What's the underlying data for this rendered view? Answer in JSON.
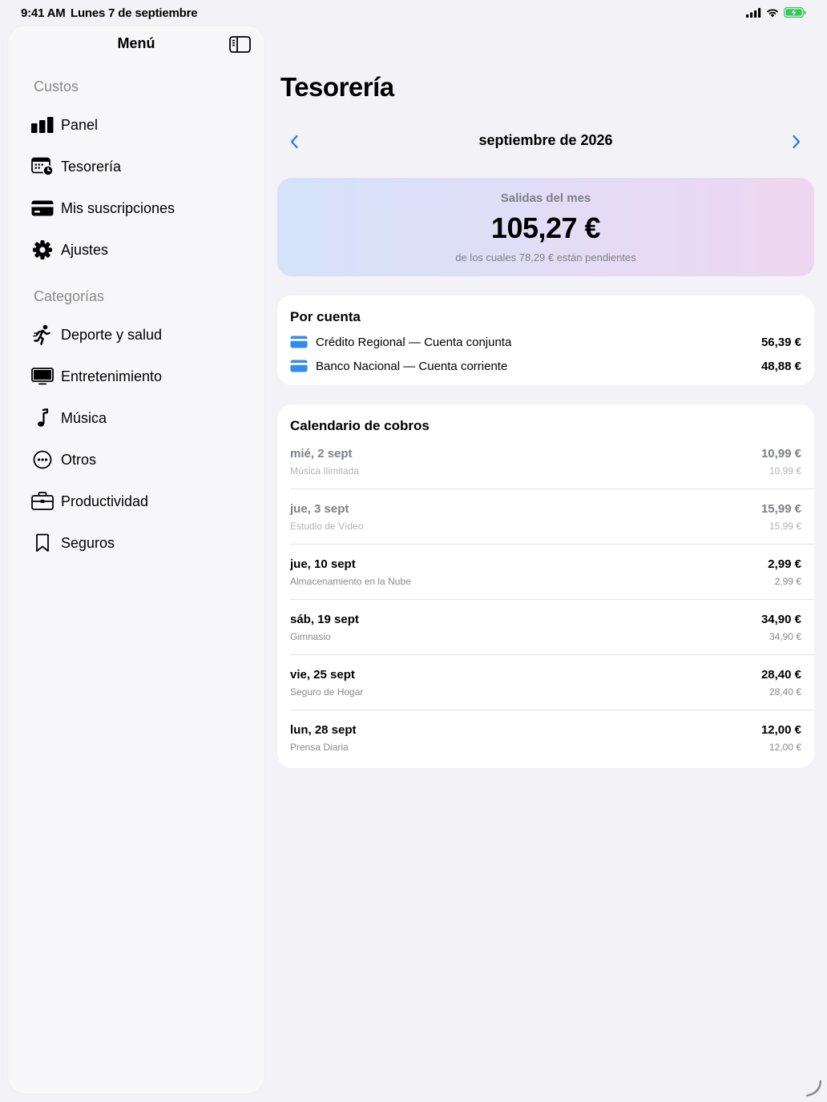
{
  "status": {
    "time": "9:41 AM",
    "date": "Lunes 7 de septiembre"
  },
  "sidebar": {
    "title": "Menú",
    "sections": [
      {
        "label": "Custos"
      },
      {
        "label": "Categorías"
      }
    ],
    "items": [
      {
        "label": "Panel",
        "icon": "chart-bar-icon"
      },
      {
        "label": "Tesorería",
        "icon": "calendar-clock-icon"
      },
      {
        "label": "Mis suscripciones",
        "icon": "credit-card-icon"
      },
      {
        "label": "Ajustes",
        "icon": "gear-icon"
      },
      {
        "label": "Deporte y salud",
        "icon": "running-figure-icon"
      },
      {
        "label": "Entretenimiento",
        "icon": "tv-icon"
      },
      {
        "label": "Música",
        "icon": "music-note-icon"
      },
      {
        "label": "Otros",
        "icon": "ellipsis-circle-icon"
      },
      {
        "label": "Productividad",
        "icon": "briefcase-icon"
      },
      {
        "label": "Seguros",
        "icon": "bookmark-icon"
      }
    ]
  },
  "main": {
    "title": "Tesorería",
    "month": "septiembre de 2026",
    "summary": {
      "label": "Salidas del mes",
      "amount": "105,27 €",
      "note": "de los cuales 78,29 € están pendientes"
    },
    "accounts": {
      "title": "Por cuenta",
      "rows": [
        {
          "name": "Crédito Regional — Cuenta conjunta",
          "amount": "56,39 €"
        },
        {
          "name": "Banco Nacional — Cuenta corriente",
          "amount": "48,88 €"
        }
      ]
    },
    "calendar": {
      "title": "Calendario de cobros",
      "rows": [
        {
          "date": "mié, 2 sept",
          "service": "Música Ilimitada",
          "amount": "10,99 €",
          "amount_sub": "10,99 €",
          "past": true
        },
        {
          "date": "jue, 3 sept",
          "service": "Estudio de Vídeo",
          "amount": "15,99 €",
          "amount_sub": "15,99 €",
          "past": true
        },
        {
          "date": "jue, 10 sept",
          "service": "Almacenamiento en la Nube",
          "amount": "2,99 €",
          "amount_sub": "2,99 €",
          "past": false
        },
        {
          "date": "sáb, 19 sept",
          "service": "Gimnasio",
          "amount": "34,90 €",
          "amount_sub": "34,90 €",
          "past": false
        },
        {
          "date": "vie, 25 sept",
          "service": "Seguro de Hogar",
          "amount": "28,40 €",
          "amount_sub": "28,40 €",
          "past": false
        },
        {
          "date": "lun, 28 sept",
          "service": "Prensa Diaria",
          "amount": "12,00 €",
          "amount_sub": "12,00 €",
          "past": false
        }
      ]
    }
  },
  "colors": {
    "accent": "#1a7cf0",
    "card_blue": "#2f8cf5",
    "battery": "#34c759"
  }
}
